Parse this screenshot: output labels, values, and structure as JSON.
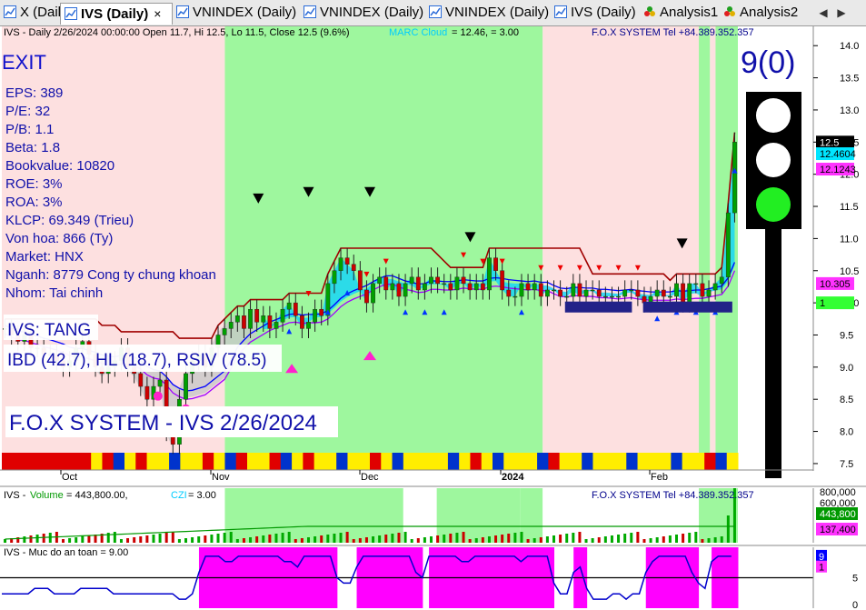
{
  "tabs": [
    {
      "label": "X (Daily)",
      "icon": "chart-icon",
      "active": false
    },
    {
      "label": "IVS (Daily)",
      "icon": "chart-icon",
      "active": true
    },
    {
      "label": "VNINDEX (Daily)",
      "icon": "chart-icon",
      "active": false
    },
    {
      "label": "VNINDEX (Daily)",
      "icon": "chart-icon",
      "active": false
    },
    {
      "label": "VNINDEX (Daily)",
      "icon": "chart-icon",
      "active": false
    },
    {
      "label": "IVS (Daily)",
      "icon": "chart-icon",
      "active": false
    },
    {
      "label": "Analysis1",
      "icon": "analysis-icon",
      "active": false
    },
    {
      "label": "Analysis2",
      "icon": "analysis-icon",
      "active": false
    }
  ],
  "tab_close_glyph": "×",
  "nav_left_glyph": "◀",
  "nav_right_glyph": "▶",
  "price_pane": {
    "header": "IVS - Daily 2/26/2024 00:00:00 Open 11.7, Hi 12.5, Lo 11.5, Close 12.5 (9.6%)",
    "header_cloud": "MARC Cloud",
    "header_cloud_value": " = 12.46,   = 3.00",
    "header_right": "F.O.X SYSTEM Tel +84.389.352.357",
    "exit_label": "EXIT",
    "fundamentals": [
      "EPS: 389",
      "P/E: 32",
      "P/B: 1.1",
      "Beta: 1.8",
      "Bookvalue: 10820",
      "ROE: 3%",
      "ROA: 3%",
      "KLCP: 69.349 (Trieu)",
      "Von hoa: 866 (Ty)",
      "Market: HNX",
      "Nganh: 8779 Cong ty chung khoan",
      "Nhom: Tai chinh"
    ],
    "trend_text": "IVS: TANG",
    "ratings_text": "IBD (42.7), HL (18.7), RSIV (78.5)",
    "banner": "F.O.X SYSTEM - IVS 2/26/2024",
    "score": "9(0)",
    "y_ticks": [
      "14.0",
      "13.5",
      "13.0",
      "12.5",
      "12.0",
      "11.5",
      "11.0",
      "10.5",
      "10.0",
      "9.5",
      "9.0",
      "8.5",
      "8.0",
      "7.5"
    ],
    "price_badges": [
      {
        "label": "12.5",
        "value": 12.5,
        "bg": "#000000",
        "fg": "#ffffff"
      },
      {
        "label": "12.4604",
        "value": 12.32,
        "bg": "#00e5ff",
        "fg": "#000000"
      },
      {
        "label": "12.1243",
        "value": 12.08,
        "bg": "#ff33ff",
        "fg": "#000000"
      },
      {
        "label": "10.305",
        "value": 10.3,
        "bg": "#ff33ff",
        "fg": "#000000"
      },
      {
        "label": "1",
        "value": 10.0,
        "bg": "#33ff33",
        "fg": "#000000"
      }
    ],
    "x_labels": [
      "Oct",
      "Nov",
      "Dec",
      "2024",
      "Feb"
    ],
    "traffic_light": [
      "white",
      "white",
      "lime"
    ],
    "colors": {
      "bg_bull": "#9ef79e",
      "bg_bear": "#fde0e0",
      "cloud": "#17d6f5",
      "exit_line": "#a00000",
      "blue_line": "#0000ff",
      "purple_line": "#a000ff"
    }
  },
  "volume_pane": {
    "header_prefix": "IVS - ",
    "header_volume": "Volume",
    "header_volume_value": " = 443,800.00, ",
    "header_czi": "CZI",
    "header_czi_value": " = 3.00",
    "header_right": "F.O.X SYSTEM Tel +84.389.352.357",
    "y_ticks": [
      "800,000",
      "600,000"
    ],
    "badges": [
      {
        "label": "443,800",
        "bg": "#009900",
        "fg": "#ffffff"
      },
      {
        "label": "137,400",
        "bg": "#ff33ff",
        "fg": "#000000"
      }
    ]
  },
  "safety_pane": {
    "header": "IVS - Muc do an toan = 9.00",
    "y_ticks": [
      "5",
      "0"
    ],
    "badges": [
      {
        "label": "9",
        "bg": "#0000ff",
        "fg": "#ffffff"
      },
      {
        "label": "1",
        "bg": "#ff33ff",
        "fg": "#000000"
      }
    ]
  },
  "chart_data": {
    "type": "candlestick",
    "symbol": "IVS",
    "timeframe": "Daily",
    "last_bar": {
      "date": "2/26/2024",
      "open": 11.7,
      "high": 12.5,
      "low": 11.5,
      "close": 12.5,
      "change_pct": 9.6
    },
    "ylim": [
      7.4,
      14.3
    ],
    "x_axis_months": [
      "Oct",
      "Nov",
      "Dec",
      "2024",
      "Feb"
    ],
    "close": [
      9.6,
      9.5,
      9.4,
      9.5,
      9.3,
      9.3,
      9.2,
      9.2,
      9.1,
      9.0,
      9.1,
      9.3,
      9.4,
      9.2,
      9.0,
      8.9,
      9.0,
      9.1,
      9.3,
      9.0,
      8.9,
      8.7,
      8.5,
      8.7,
      8.8,
      8.0,
      7.8,
      8.5,
      8.9,
      9.1,
      9.2,
      9.0,
      9.3,
      9.5,
      9.6,
      9.7,
      9.8,
      9.6,
      9.9,
      9.7,
      9.8,
      9.6,
      9.7,
      9.9,
      10.0,
      9.8,
      9.6,
      9.7,
      9.9,
      9.8,
      10.3,
      10.5,
      10.7,
      10.6,
      10.5,
      10.2,
      10.0,
      10.3,
      10.4,
      10.2,
      10.3,
      10.1,
      10.3,
      10.4,
      10.2,
      10.3,
      10.4,
      10.3,
      10.3,
      10.2,
      10.4,
      10.3,
      10.2,
      10.3,
      10.2,
      10.7,
      10.5,
      10.2,
      10.1,
      10.1,
      10.3,
      10.2,
      10.3,
      10.1,
      10.2,
      10.2,
      10.1,
      10.1,
      10.3,
      10.1,
      10.2,
      10.2,
      10.1,
      10.1,
      10.1,
      10.1,
      10.2,
      10.2,
      10.1,
      10.0,
      10.1,
      10.2,
      10.1,
      10.1,
      10.3,
      10.0,
      10.3,
      10.3,
      10.1,
      10.2,
      10.3,
      10.4,
      11.4,
      12.5
    ],
    "marc_cloud": 12.46,
    "volume_last": 443800,
    "volume_ma": 137400,
    "czi": 3.0,
    "safety_level": 9.0
  }
}
